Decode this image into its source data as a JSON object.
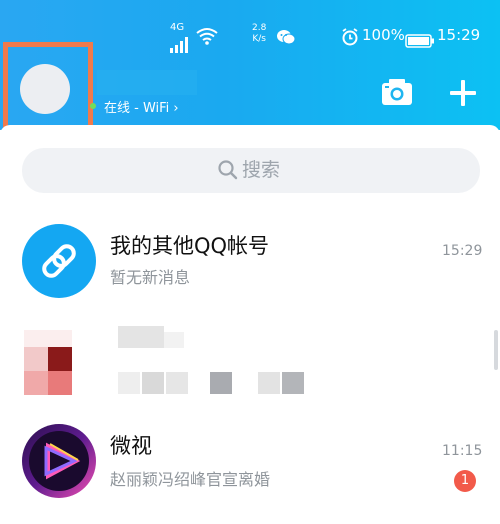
{
  "status_bar": {
    "network": "4G",
    "speed_value": "2.8",
    "speed_unit": "K/s",
    "battery": "100%",
    "time": "15:29"
  },
  "header": {
    "online_status": "在线 - WiFi",
    "online_chevron": "›"
  },
  "search": {
    "label": "搜索"
  },
  "conversations": [
    {
      "title": "我的其他QQ帐号",
      "subtitle": "暂无新消息",
      "time": "15:29",
      "icon": "link-icon"
    },
    {
      "title": "",
      "subtitle": "",
      "time": "",
      "icon": "pixelated-avatar"
    },
    {
      "title": "微视",
      "subtitle": "赵丽颖冯绍峰官宣离婚",
      "time": "11:15",
      "unread": "1",
      "icon": "weishi-logo"
    }
  ],
  "colors": {
    "header_start": "#2aa7f2",
    "header_end": "#0cc1f3",
    "highlight_border": "#f07a4c",
    "badge": "#f25a4a",
    "link_avatar": "#14a7f2"
  }
}
